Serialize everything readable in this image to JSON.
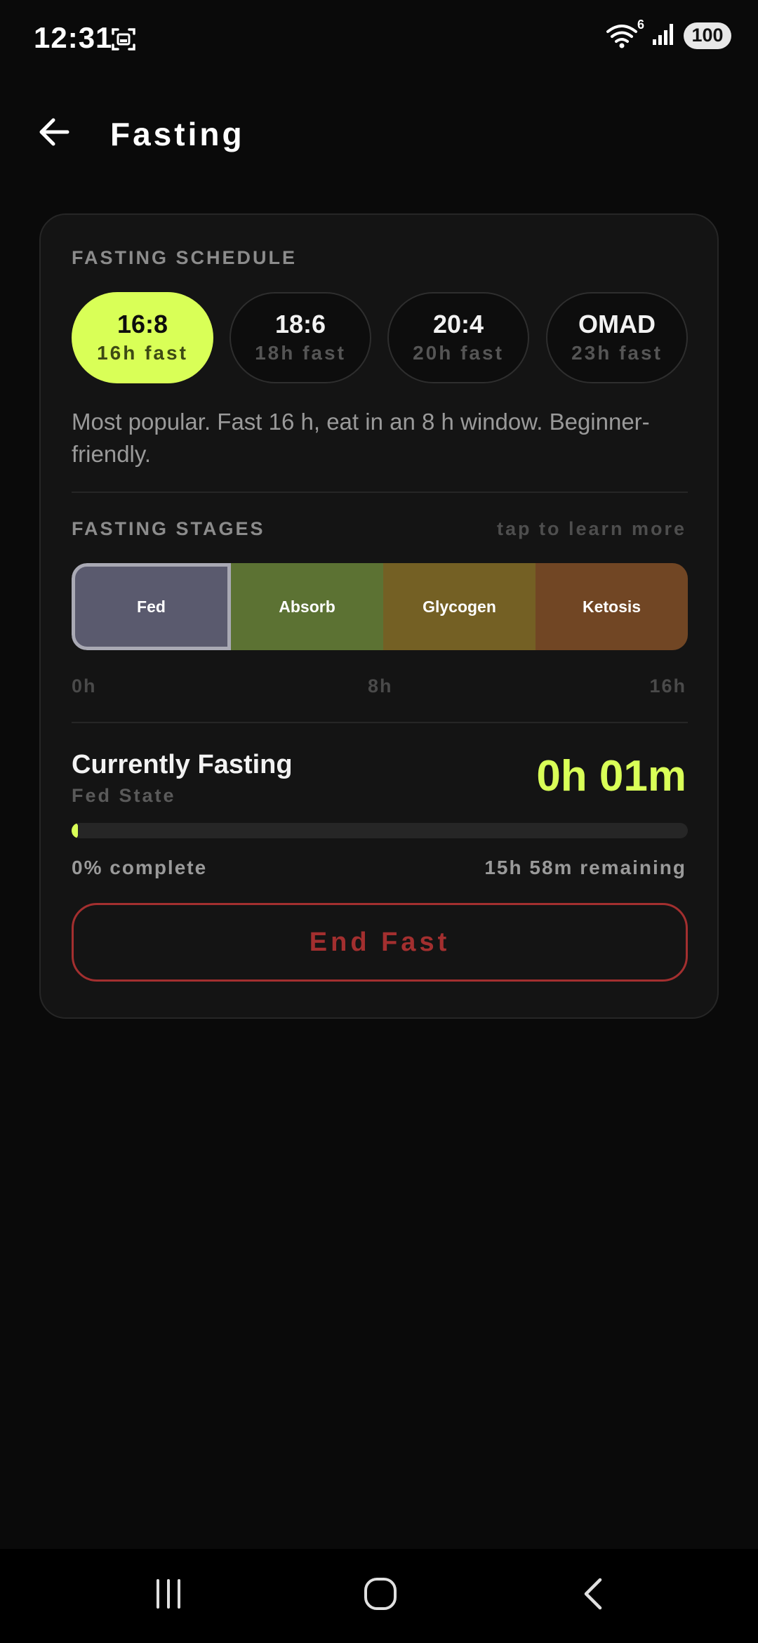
{
  "status_bar": {
    "time": "12:31",
    "wifi_badge": "6",
    "battery": "100",
    "icons": [
      "screenshot-icon",
      "wifi-icon",
      "signal-icon",
      "battery-icon"
    ]
  },
  "header": {
    "title": "Fasting",
    "back_icon": "arrow-left-icon"
  },
  "schedule": {
    "label": "FASTING SCHEDULE",
    "options": [
      {
        "ratio": "16:8",
        "hours": "16h fast",
        "selected": true
      },
      {
        "ratio": "18:6",
        "hours": "18h fast",
        "selected": false
      },
      {
        "ratio": "20:4",
        "hours": "20h fast",
        "selected": false
      },
      {
        "ratio": "OMAD",
        "hours": "23h fast",
        "selected": false
      }
    ],
    "description": "Most popular. Fast 16 h, eat in an 8 h window. Beginner-friendly."
  },
  "stages": {
    "label": "FASTING STAGES",
    "hint": "tap to learn more",
    "items": [
      {
        "name": "Fed",
        "color": "#5a5a6e",
        "current": true
      },
      {
        "name": "Absorb",
        "color": "#5c7233",
        "current": false
      },
      {
        "name": "Glycogen",
        "color": "#746024",
        "current": false
      },
      {
        "name": "Ketosis",
        "color": "#714624",
        "current": false
      }
    ],
    "ticks": [
      "0h",
      "8h",
      "16h"
    ]
  },
  "current": {
    "title": "Currently Fasting",
    "stage": "Fed State",
    "elapsed": "0h 01m",
    "progress_fraction": 0.01,
    "percent_label": "0% complete",
    "remaining_label": "15h 58m remaining",
    "end_button": "End Fast"
  },
  "colors": {
    "accent": "#d9ff57",
    "danger": "#a32f2f",
    "background": "#0a0a0a",
    "card": "#141414"
  },
  "nav": {
    "icons": [
      "recents-icon",
      "home-icon",
      "back-icon"
    ]
  }
}
